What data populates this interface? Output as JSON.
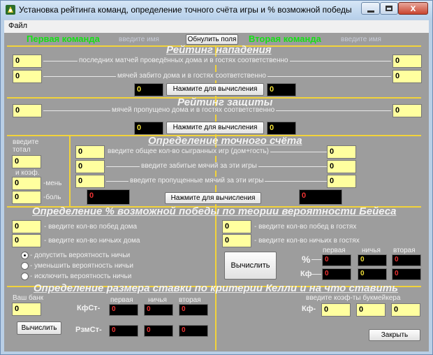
{
  "window": {
    "title": "Установка рейтинга команд, определение точного счёта игры и % возможной победы",
    "close_glyph": "x"
  },
  "menu": {
    "file": "Файл"
  },
  "header": {
    "first_team": "Первая команда",
    "first_team_hint": "введите имя",
    "reset_button": "Обнулить поля",
    "second_team": "Вторая команда",
    "second_team_hint": "введите имя"
  },
  "attack": {
    "title": "Рейтинг нападения",
    "row1_label": "последних матчей проведённых дома и в гостях соответственно",
    "row2_label": "мячей забито дома и в гостях соответственно",
    "left_inputs": [
      "0",
      "0"
    ],
    "right_inputs": [
      "0",
      "0"
    ],
    "result_left": "0",
    "result_right": "0",
    "calc_button": "Нажмите для вычисления"
  },
  "defense": {
    "title": "Рейтинг защиты",
    "row1_label": "мячей пропущено дома и в гостях соответственно",
    "left_input": "0",
    "right_input": "0",
    "result_left": "0",
    "result_right": "0",
    "calc_button": "Нажмите для вычисления"
  },
  "total": {
    "enter_label": "введите",
    "total_label": "тотал",
    "total_value": "0",
    "coef_label": "и коэф.",
    "less_label": "-мень",
    "less_value": "0",
    "more_label": "-боль",
    "more_value": "0"
  },
  "exact_score": {
    "title": "Определение точного счёта",
    "row1_label": "введите общее кол-во сыгранных игр (дом+гость)",
    "row2_label": "введите  забитые мячий за эти игры",
    "row3_label": "введите  пропущенные мячий за эти игры",
    "left_inputs": [
      "0",
      "0",
      "0"
    ],
    "right_inputs": [
      "0",
      "0",
      "0"
    ],
    "result_left": "0",
    "result_right": "0",
    "calc_button": "Нажмите для вычисления"
  },
  "bayes": {
    "title": "Определение % возможной победы по теории вероятности Бейеса",
    "home_wins_label": "- введите кол-во  побед дома",
    "home_draws_label": "- введите кол-во ничьих дома",
    "away_wins_label": "- введите кол-во  побед в гостях",
    "away_draws_label": "- введите кол-во ничьих в гостях",
    "home_wins": "0",
    "home_draws": "0",
    "away_wins": "0",
    "away_draws": "0",
    "radio_options": [
      "- допустить вероятность ничьи",
      "- уменьшить вероятность ничьи",
      "- исключить вероятность ничьи"
    ],
    "selected_option": 0,
    "calc_button": "Вычислить",
    "percent_label": "%",
    "coef_label": "Кф",
    "col_first": "первая",
    "col_draw": "ничья",
    "col_second": "вторая",
    "percent_values": [
      "0",
      "0",
      "0"
    ],
    "coef_values": [
      "0",
      "0",
      "0"
    ]
  },
  "kelly": {
    "title": "Определение размера ставки по критерии Келли и на что ставить",
    "bank_label": "Ваш банк",
    "bank_value": "0",
    "calc_button": "Вычислить",
    "kf_label": "КфСт-",
    "size_label": "РзмСт-",
    "col_first": "первая",
    "col_draw": "ничья",
    "col_second": "вторая",
    "kf_values": [
      "0",
      "0",
      "0"
    ],
    "size_values": [
      "0",
      "0",
      "0"
    ],
    "bookmaker_label": "введите коэф-ты букмейкера",
    "bookmaker_coef_label": "Кф-",
    "bookmaker_values": [
      "0",
      "0",
      "0"
    ],
    "close_button": "Закрыть"
  }
}
